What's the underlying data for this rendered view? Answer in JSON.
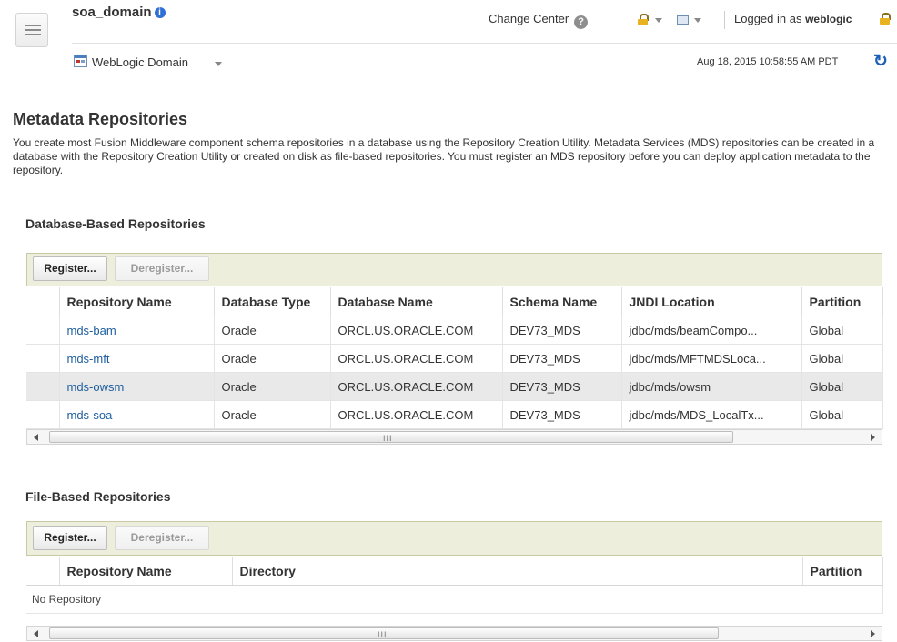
{
  "header": {
    "domain_name": "soa_domain",
    "change_center": "Change Center",
    "logged_in_prefix": "Logged in as",
    "username": "weblogic",
    "domain_menu": "WebLogic Domain",
    "timestamp": "Aug 18, 2015 10:58:55 AM PDT"
  },
  "page": {
    "title": "Metadata Repositories",
    "description": "You create most Fusion Middleware component schema repositories in a database using the Repository Creation Utility. Metadata Services (MDS) repositories can be created in a database with the Repository Creation Utility or created on disk as file-based repositories. You must register an MDS repository before you can deploy application metadata to the repository."
  },
  "db_section": {
    "title": "Database-Based Repositories",
    "register_label": "Register...",
    "deregister_label": "Deregister...",
    "columns": [
      "Repository Name",
      "Database Type",
      "Database Name",
      "Schema Name",
      "JNDI Location",
      "Partition"
    ],
    "rows": [
      [
        "mds-bam",
        "Oracle",
        "ORCL.US.ORACLE.COM",
        "DEV73_MDS",
        "jdbc/mds/beamCompo...",
        "Global"
      ],
      [
        "mds-mft",
        "Oracle",
        "ORCL.US.ORACLE.COM",
        "DEV73_MDS",
        "jdbc/mds/MFTMDSLoca...",
        "Global"
      ],
      [
        "mds-owsm",
        "Oracle",
        "ORCL.US.ORACLE.COM",
        "DEV73_MDS",
        "jdbc/mds/owsm",
        "Global"
      ],
      [
        "mds-soa",
        "Oracle",
        "ORCL.US.ORACLE.COM",
        "DEV73_MDS",
        "jdbc/mds/MDS_LocalTx...",
        "Global"
      ]
    ],
    "scroll_grip": "III"
  },
  "file_section": {
    "title": "File-Based Repositories",
    "register_label": "Register...",
    "deregister_label": "Deregister...",
    "columns": [
      "Repository Name",
      "Directory",
      "Partition"
    ],
    "empty_text": "No Repository",
    "scroll_grip": "III"
  }
}
